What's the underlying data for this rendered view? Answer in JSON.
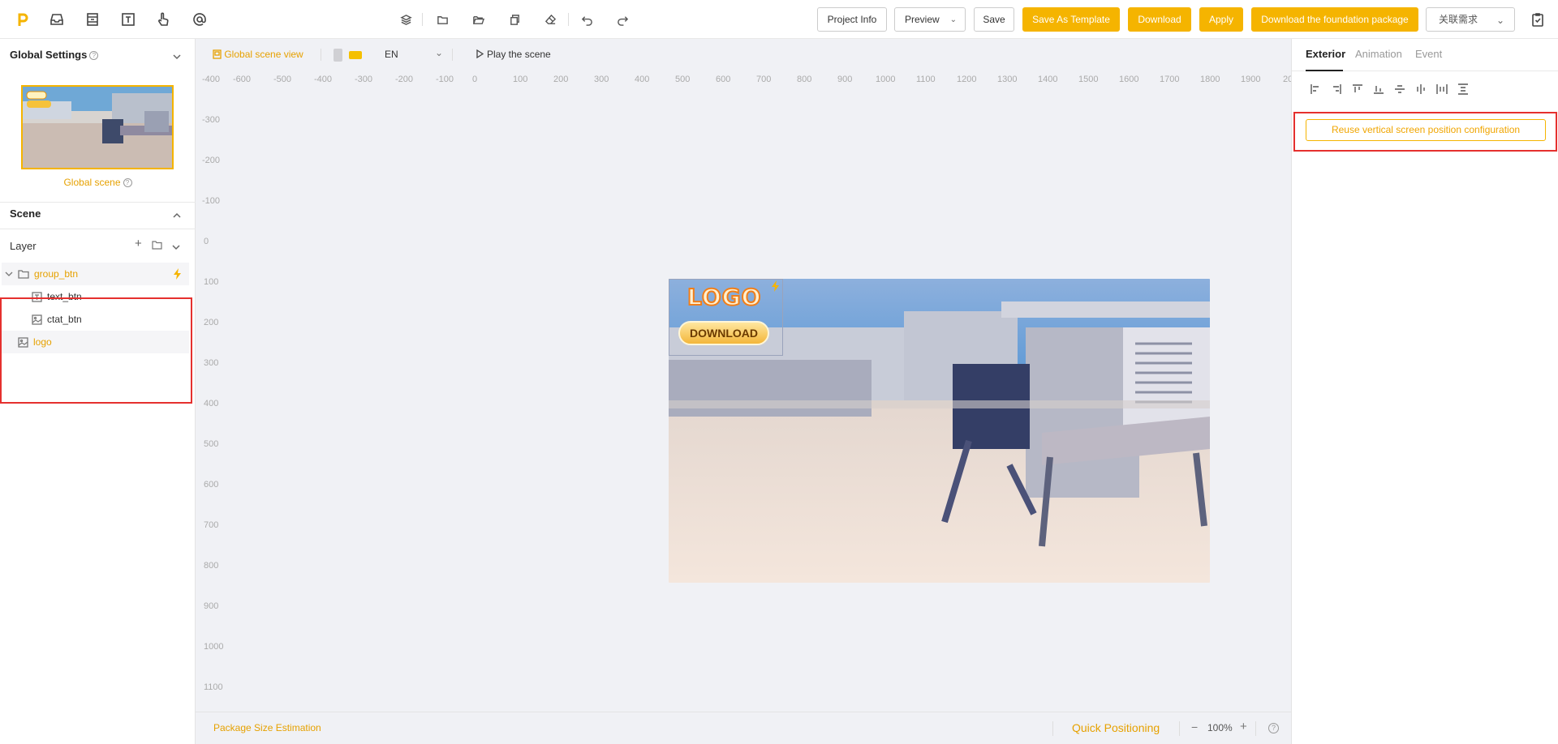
{
  "toolbar": {
    "project_info": "Project Info",
    "preview": "Preview",
    "save": "Save",
    "save_as_template": "Save As Template",
    "download": "Download",
    "apply": "Apply",
    "download_foundation": "Download the foundation package",
    "linked_requirement": "关联需求",
    "left_icons": [
      "logo-icon",
      "inbox-icon",
      "layout-icon",
      "text-icon",
      "hand-pointer-icon",
      "at-icon"
    ],
    "middle_icons": [
      "layers-icon",
      "folder-icon",
      "folder-open-icon",
      "copy-icon",
      "eraser-icon",
      "undo-icon",
      "redo-icon"
    ]
  },
  "left": {
    "global_settings": "Global Settings",
    "global_scene": "Global scene",
    "scene_title": "Scene",
    "layer_title": "Layer",
    "layers": [
      {
        "label": "group_btn",
        "type": "folder",
        "highlight": true
      },
      {
        "label": "text_btn",
        "type": "text"
      },
      {
        "label": "ctat_btn",
        "type": "image"
      },
      {
        "label": "logo",
        "type": "image",
        "highlight": true
      }
    ]
  },
  "canvas": {
    "global_scene_view": "Global scene view",
    "language": "EN",
    "play_scene": "Play the scene",
    "h_ticks": [
      "-600",
      "-500",
      "-400",
      "-300",
      "-200",
      "-100",
      "0",
      "100",
      "200",
      "300",
      "400",
      "500",
      "600",
      "700",
      "800",
      "900",
      "1000",
      "1100",
      "1200",
      "1300",
      "1400",
      "1500",
      "1600",
      "1700",
      "1800",
      "1900",
      "20"
    ],
    "v_ticks": [
      "-400",
      "-300",
      "-200",
      "-100",
      "0",
      "100",
      "200",
      "300",
      "400",
      "500",
      "600",
      "700",
      "800",
      "900",
      "1000",
      "1100"
    ],
    "logo_text": "LOGO",
    "download_text": "DOWNLOAD",
    "package_size": "Package Size Estimation",
    "quick_positioning": "Quick Positioning",
    "zoom": "100%",
    "zoom_minus": "−",
    "zoom_plus": "+"
  },
  "right": {
    "tabs": [
      "Exterior",
      "Animation",
      "Event"
    ],
    "active_tab": "Exterior",
    "reuse_button": "Reuse vertical screen position configuration"
  },
  "colors": {
    "accent": "#f5b400",
    "highlight_text": "#e6a100",
    "red_box": "#e5302e"
  }
}
